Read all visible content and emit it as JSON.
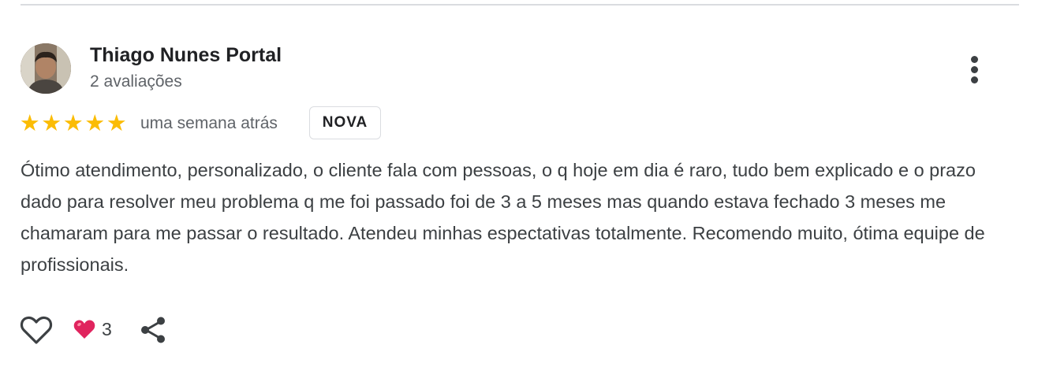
{
  "review": {
    "reviewer_name": "Thiago Nunes Portal",
    "review_count": "2 avaliações",
    "rating": 5,
    "rating_max": 5,
    "time_ago": "uma semana atrás",
    "badge": "NOVA",
    "text": "Ótimo atendimento, personalizado, o cliente fala com pessoas, o q hoje em dia é raro, tudo bem explicado e o prazo dado para resolver meu problema q me foi passado foi de 3 a 5 meses mas quando estava fechado 3 meses me chamaram para me passar o resultado. Atendeu minhas espectativas totalmente. Recomendo muito, ótima equipe de profissionais.",
    "reactions": {
      "heart_count": "3"
    }
  },
  "icons": {
    "more": "more-vert-icon",
    "like": "heart-outline-icon",
    "reaction": "red-heart-emoji",
    "share": "share-icon",
    "star": "star-icon"
  },
  "colors": {
    "star": "#fbbc04",
    "heart": "#e0245e",
    "name": "#202124",
    "secondary": "#5f6368",
    "body_text": "#3c4043",
    "divider": "#dadce0"
  }
}
